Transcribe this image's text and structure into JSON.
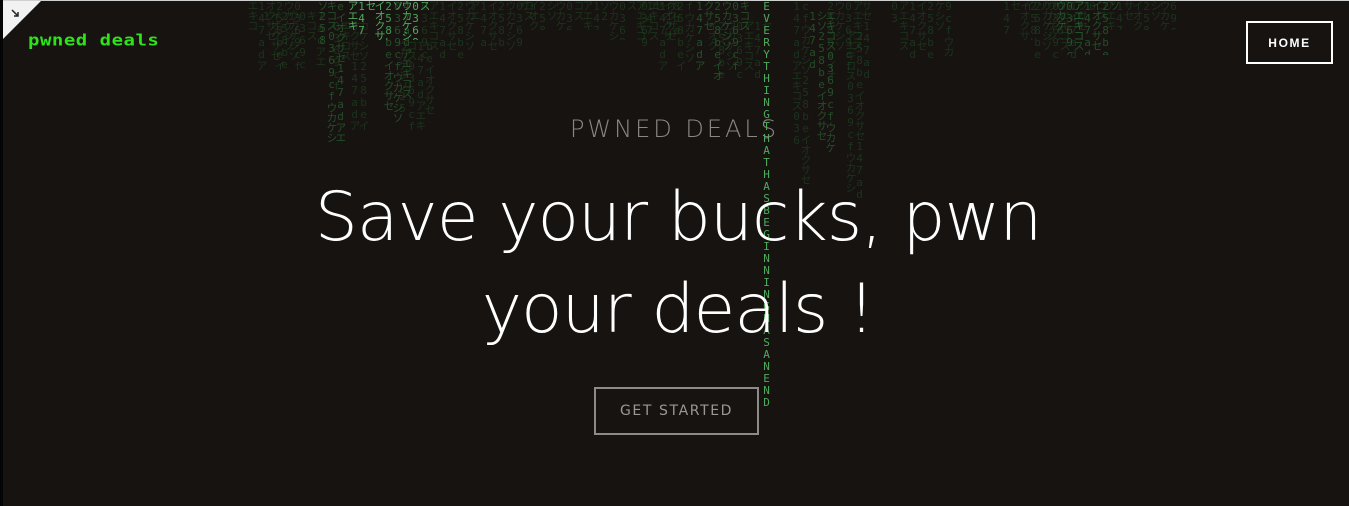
{
  "header": {
    "logo_text": "pwned deals",
    "nav": {
      "home_label": "HOME"
    }
  },
  "hero": {
    "eyebrow": "PWNED DEALS",
    "headline": "Save your bucks, pwn your deals !",
    "cta_label": "GET STARTED"
  },
  "background": {
    "rain_text": "EVERYTHING THAT HAS BEGINNING HAS AN END",
    "rain_color": "#2f7d3a",
    "base_color": "#171311"
  },
  "colors": {
    "logo": "#2fe31a",
    "headline": "#ffffff",
    "eyebrow": "#8a8785",
    "cta_border": "#8d8b89"
  }
}
